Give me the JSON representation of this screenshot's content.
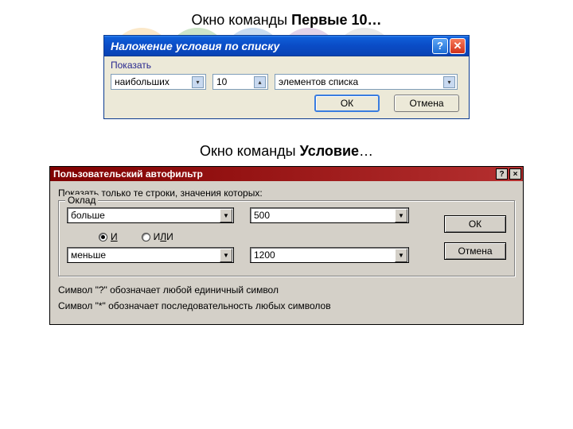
{
  "heading1_prefix": "Окно команды ",
  "heading1_bold": "Первые 10…",
  "heading2_prefix": "Окно команды ",
  "heading2_bold": "Условие",
  "heading2_suffix": "…",
  "win1": {
    "title": "Наложение условия по списку",
    "group_label": "Показать",
    "combo_mode": "наибольших",
    "combo_count": "10",
    "combo_unit": "элементов списка",
    "ok": "ОК",
    "cancel": "Отмена"
  },
  "win2": {
    "title": "Пользовательский автофильтр",
    "prompt": "Показать только те строки, значения которых:",
    "legend": "Оклад",
    "op1": "больше",
    "val1": "500",
    "radio_and": "И",
    "radio_or": "ИЛИ",
    "op2": "меньше",
    "val2": "1200",
    "ok": "ОК",
    "cancel": "Отмена",
    "hint1": "Символ \"?\" обозначает любой единичный символ",
    "hint2": "Символ \"*\" обозначает последовательность любых символов"
  }
}
